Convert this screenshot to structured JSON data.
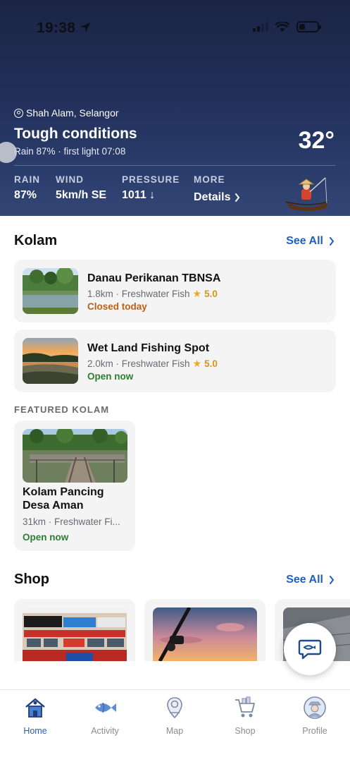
{
  "status_bar": {
    "time": "19:38"
  },
  "weather": {
    "location": "Shah Alam, Selangor",
    "headline": "Tough conditions",
    "subline": "Rain 87% · first light 07:08",
    "temperature": "32°",
    "stats": [
      {
        "label": "RAIN",
        "value": "87%"
      },
      {
        "label": "WIND",
        "value": "5km/h SE"
      },
      {
        "label": "PRESSURE",
        "value": "1011 ↓"
      },
      {
        "label": "MORE",
        "value": "Details"
      }
    ]
  },
  "kolam": {
    "title": "Kolam",
    "see_all": "See All",
    "items": [
      {
        "name": "Danau Perikanan TBNSA",
        "meta": "1.8km · Freshwater Fish",
        "rating": "5.0",
        "status": "Closed today"
      },
      {
        "name": "Wet Land Fishing Spot",
        "meta": "2.0km · Freshwater Fish",
        "rating": "5.0",
        "status": "Open now"
      }
    ]
  },
  "featured": {
    "label": "FEATURED KOLAM",
    "item": {
      "name": "Kolam Pancing Desa Aman",
      "meta": "31km · Freshwater Fi...",
      "status": "Open now"
    }
  },
  "shop": {
    "title": "Shop",
    "see_all": "See All"
  },
  "tabs": [
    {
      "label": "Home",
      "icon": "home-icon",
      "active": true
    },
    {
      "label": "Activity",
      "icon": "fish-icon",
      "active": false
    },
    {
      "label": "Map",
      "icon": "map-icon",
      "active": false
    },
    {
      "label": "Shop",
      "icon": "cart-icon",
      "active": false
    },
    {
      "label": "Profile",
      "icon": "profile-icon",
      "active": false
    }
  ],
  "colors": {
    "accent": "#1f5fbf",
    "open": "#2e7d32",
    "closed": "#b8621a",
    "rating": "#f1a81b",
    "hero": "#22305a"
  }
}
